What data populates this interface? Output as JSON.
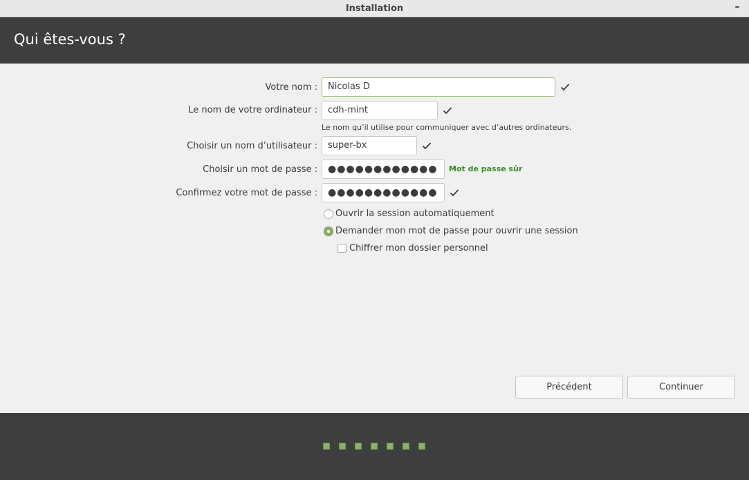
{
  "window": {
    "title": "Installation",
    "minimize_glyph": "–"
  },
  "header": {
    "title": "Qui êtes-vous ?"
  },
  "form": {
    "name_label": "Votre nom :",
    "name_value": "Nicolas D",
    "computer_label": "Le nom de votre ordinateur :",
    "computer_value": "cdh-mint",
    "computer_hint": "Le nom qu’il utilise pour communiquer avec d’autres ordinateurs.",
    "username_label": "Choisir un nom d’utilisateur :",
    "username_value": "super-bx",
    "password_label": "Choisir un mot de passe :",
    "password_value": "●●●●●●●●●●●●",
    "password_strength": "Mot de passe sûr",
    "confirm_label": "Confirmez votre mot de passe :",
    "confirm_value": "●●●●●●●●●●●●"
  },
  "options": {
    "auto_login": "Ouvrir la session automatiquement",
    "require_password": "Demander mon mot de passe pour ouvrir une session",
    "encrypt_home": "Chiffrer mon dossier personnel",
    "selected": "require_password",
    "encrypt_checked": false
  },
  "buttons": {
    "back": "Précédent",
    "continue": "Continuer"
  },
  "progress": {
    "steps": 7
  },
  "colors": {
    "accent": "#8fb06a",
    "header_bg": "#3e3e3e",
    "strength_text": "#3a8a2a"
  },
  "icons": {
    "valid": "check-icon"
  }
}
